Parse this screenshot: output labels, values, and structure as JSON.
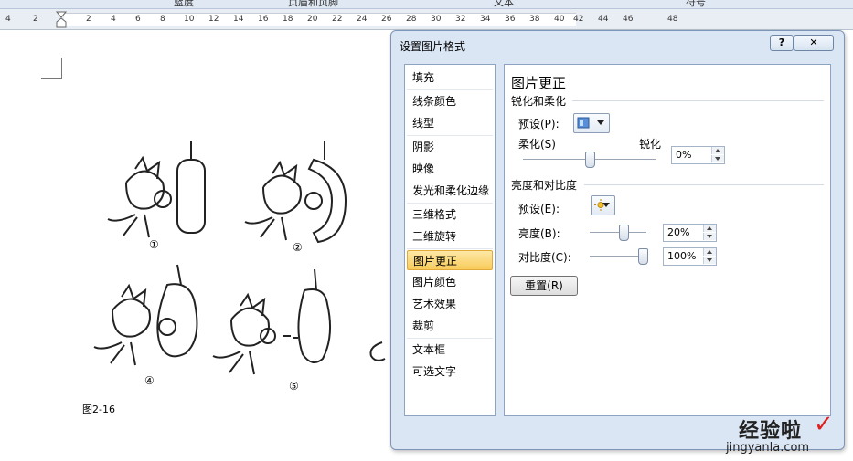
{
  "ribbon": {
    "groups": [
      "蓝度",
      "页眉和页脚",
      "文本",
      "符号"
    ]
  },
  "ruler": {
    "numbers": [
      "4",
      "2",
      "2",
      "4",
      "6",
      "8",
      "10",
      "12",
      "14",
      "16",
      "18",
      "20",
      "22",
      "24",
      "26",
      "28",
      "30",
      "32",
      "34",
      "36",
      "38",
      "40",
      "42",
      "44",
      "46",
      "48"
    ]
  },
  "document": {
    "figure_caption": "图2-16",
    "figure_labels": [
      "①",
      "②",
      "④",
      "⑤"
    ]
  },
  "dialog": {
    "title": "设置图片格式",
    "help_label": "?",
    "close_label": "✕",
    "nav_items": [
      "填充",
      "线条颜色",
      "线型",
      "阴影",
      "映像",
      "发光和柔化边缘",
      "三维格式",
      "三维旋转",
      "图片更正",
      "图片颜色",
      "艺术效果",
      "裁剪",
      "文本框",
      "可选文字"
    ],
    "selected_nav": "图片更正",
    "pane": {
      "title": "图片更正",
      "sharpen": {
        "heading": "锐化和柔化",
        "preset_label": "预设(P):",
        "preset_icon": "sharpen-preset-icon",
        "soften_label": "柔化(S)",
        "sharpen_label": "锐化",
        "slider_value": 0,
        "value": "0%"
      },
      "brightness_contrast": {
        "heading": "亮度和对比度",
        "preset_label": "预设(E):",
        "preset_icon": "sun-icon",
        "brightness_label": "亮度(B):",
        "brightness_value": "20%",
        "brightness_slider": 0.6,
        "contrast_label": "对比度(C):",
        "contrast_value": "100%",
        "contrast_slider": 1.0
      },
      "reset_label": "重置(R)"
    }
  },
  "watermark": {
    "main": "经验啦",
    "sub": "jingyanla.com"
  },
  "colors": {
    "selected_nav": "#f9cc5b",
    "dialog_bg": "#dbe6f4",
    "watermark_check": "#e02020"
  }
}
